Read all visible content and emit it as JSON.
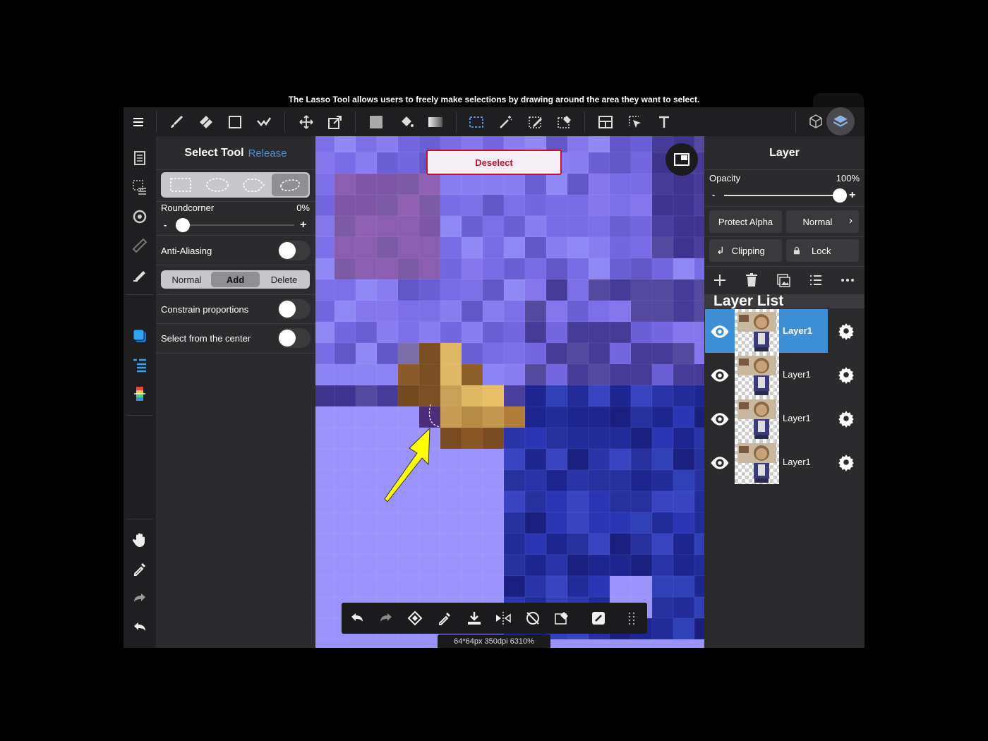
{
  "caption": "The Lasso Tool allows users to freely make selections by drawing around the area they want to select.",
  "toolbar": {
    "tools": [
      "menu-icon",
      "brush-icon",
      "eraser-icon",
      "shape-icon",
      "smudge-icon",
      "move-icon",
      "transform-icon",
      "fill-color-icon",
      "bucket-icon",
      "gradient-icon",
      "select-rect-icon",
      "magic-wand-icon",
      "select-pen-icon",
      "select-eraser-icon",
      "panel-layout-icon",
      "select-arrow-icon",
      "text-icon"
    ],
    "right_icons": [
      "3d-cube-icon",
      "layers-icon"
    ]
  },
  "left_rail": [
    "page-icon",
    "selection-icon",
    "snap-icon",
    "ruler-icon",
    "fill-pen-icon",
    "color-swatch-icon",
    "layers-list-icon",
    "palette-icon",
    "hand-icon",
    "eyedropper-icon",
    "redo-icon",
    "undo-icon"
  ],
  "select_panel": {
    "title": "Select Tool",
    "release": "Release",
    "shapes": [
      "rectangle",
      "ellipse",
      "polygon",
      "lasso"
    ],
    "active_shape": "lasso",
    "roundcorner_label": "Roundcorner",
    "roundcorner_value": "0%",
    "roundcorner_level": 0,
    "minus": "-",
    "plus": "+",
    "anti_aliasing": "Anti-Aliasing",
    "modes": [
      "Normal",
      "Add",
      "Delete"
    ],
    "active_mode": "Add",
    "constrain": "Constrain proportions",
    "from_center": "Select from the center"
  },
  "canvas": {
    "deselect": "Deselect",
    "status": "64*64px 350dpi 6310%",
    "accent": "#ffff00"
  },
  "bottom_bar": [
    "undo-icon",
    "redo-icon",
    "rotate-icon",
    "eyedropper-icon",
    "download-icon",
    "flip-icon",
    "no-rotate-icon",
    "select-eraser-icon",
    "edit-icon",
    "grid-icon"
  ],
  "layer_panel": {
    "title": "Layer",
    "opacity_label": "Opacity",
    "opacity_value": "100%",
    "opacity_level": 1.0,
    "minus": "-",
    "plus": "+",
    "protect_alpha": "Protect Alpha",
    "blend": "Normal",
    "clipping": "Clipping",
    "lock": "Lock",
    "list_title": "Layer List",
    "layers": [
      {
        "name": "Layer1",
        "selected": true
      },
      {
        "name": "Layer1",
        "selected": false
      },
      {
        "name": "Layer1",
        "selected": false
      },
      {
        "name": "Layer1",
        "selected": false
      }
    ],
    "selected_color": "#3e8fd6"
  }
}
